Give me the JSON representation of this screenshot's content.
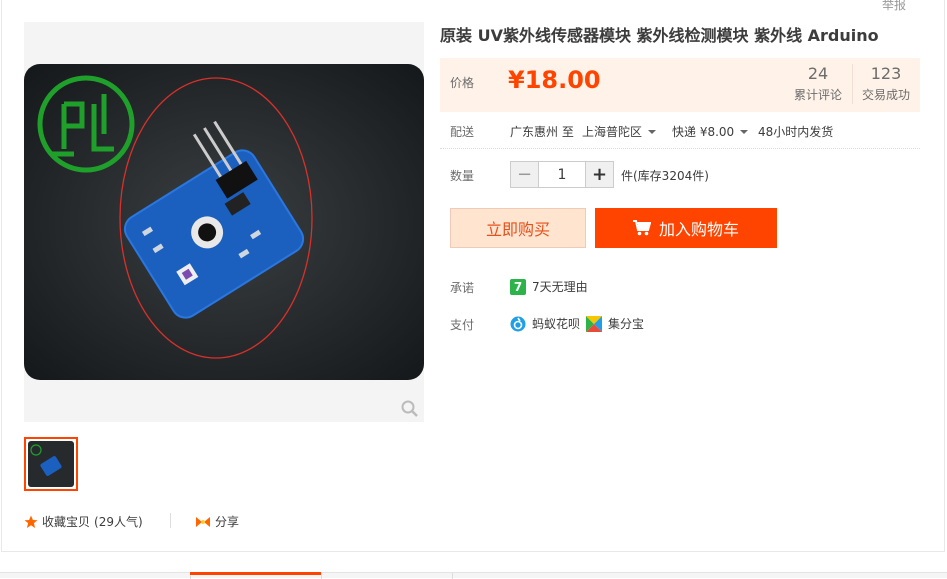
{
  "header": {
    "report_label": "举报"
  },
  "product": {
    "title": "原装 UV紫外线传感器模块 紫外线检测模块 紫外线 Arduino",
    "price_label": "价格",
    "price": "¥18.00",
    "reviews_count": "24",
    "reviews_label": "累计评论",
    "sales_count": "123",
    "sales_label": "交易成功"
  },
  "shipping": {
    "label": "配送",
    "from": "广东惠州 至",
    "to": "上海普陀区",
    "method": "快递 ¥8.00",
    "dispatch": "48小时内发货"
  },
  "quantity": {
    "label": "数量",
    "minus": "−",
    "value": "1",
    "plus": "+",
    "stock": "件(库存3204件)"
  },
  "actions": {
    "buy_now": "立即购买",
    "add_to_cart": "加入购物车"
  },
  "promise": {
    "label": "承诺",
    "badge": "7",
    "text": "7天无理由"
  },
  "payment": {
    "label": "支付",
    "method1": "蚂蚁花呗",
    "method2": "集分宝"
  },
  "social": {
    "favorite": "收藏宝贝",
    "favorite_count": "(29人气)",
    "share": "分享"
  },
  "colors": {
    "accent": "#ff4400",
    "price_bg": "#fff2e8",
    "board_blue": "#1b5fbf"
  }
}
